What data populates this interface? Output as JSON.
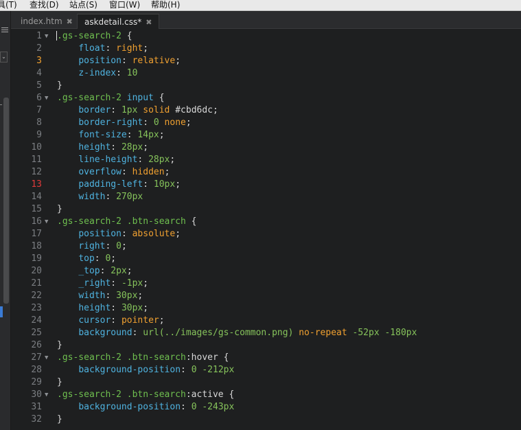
{
  "menu": {
    "items": [
      "具(T)",
      "查找(D)",
      "站点(S)",
      "窗口(W)",
      "帮助(H)"
    ]
  },
  "tabs": [
    {
      "label": "index.htm",
      "active": false
    },
    {
      "label": "askdetail.css*",
      "active": true
    }
  ],
  "editor": {
    "colors": {
      "background": "#1e1f20",
      "selector": "#6fbf4f",
      "property": "#4fb3e0",
      "value": "#f0a030",
      "number": "#86c35b",
      "punctuation": "#d8d8d8",
      "line_number": "#7b7e82",
      "line_number_warning": "#f0a030",
      "line_number_error": "#e03a3a"
    },
    "lines": [
      {
        "n": "1",
        "fold": true,
        "status": "",
        "tokens": [
          [
            "sel",
            ".gs-search-2 "
          ],
          [
            "punc",
            "{"
          ]
        ]
      },
      {
        "n": "2",
        "fold": false,
        "status": "",
        "tokens": [
          [
            "punc",
            "    "
          ],
          [
            "prop",
            "float"
          ],
          [
            "punc",
            ": "
          ],
          [
            "val",
            "right"
          ],
          [
            "punc",
            ";"
          ]
        ]
      },
      {
        "n": "3",
        "fold": false,
        "status": "warn",
        "tokens": [
          [
            "punc",
            "    "
          ],
          [
            "prop",
            "position"
          ],
          [
            "punc",
            ": "
          ],
          [
            "val",
            "relative"
          ],
          [
            "punc",
            ";"
          ]
        ]
      },
      {
        "n": "4",
        "fold": false,
        "status": "",
        "tokens": [
          [
            "punc",
            "    "
          ],
          [
            "prop",
            "z-index"
          ],
          [
            "punc",
            ": "
          ],
          [
            "num",
            "10"
          ]
        ]
      },
      {
        "n": "5",
        "fold": false,
        "status": "",
        "tokens": [
          [
            "punc",
            "}"
          ]
        ]
      },
      {
        "n": "6",
        "fold": true,
        "status": "",
        "tokens": [
          [
            "sel",
            ".gs-search-2 "
          ],
          [
            "tag",
            "input"
          ],
          [
            "punc",
            " {"
          ]
        ]
      },
      {
        "n": "7",
        "fold": false,
        "status": "",
        "tokens": [
          [
            "punc",
            "    "
          ],
          [
            "prop",
            "border"
          ],
          [
            "punc",
            ": "
          ],
          [
            "num",
            "1px"
          ],
          [
            "punc",
            " "
          ],
          [
            "val",
            "solid"
          ],
          [
            "punc",
            " #cbd6dc;"
          ]
        ]
      },
      {
        "n": "8",
        "fold": false,
        "status": "",
        "tokens": [
          [
            "punc",
            "    "
          ],
          [
            "prop",
            "border-right"
          ],
          [
            "punc",
            ": "
          ],
          [
            "num",
            "0"
          ],
          [
            "punc",
            " "
          ],
          [
            "val",
            "none"
          ],
          [
            "punc",
            ";"
          ]
        ]
      },
      {
        "n": "9",
        "fold": false,
        "status": "",
        "tokens": [
          [
            "punc",
            "    "
          ],
          [
            "prop",
            "font-size"
          ],
          [
            "punc",
            ": "
          ],
          [
            "num",
            "14px"
          ],
          [
            "punc",
            ";"
          ]
        ]
      },
      {
        "n": "10",
        "fold": false,
        "status": "",
        "tokens": [
          [
            "punc",
            "    "
          ],
          [
            "prop",
            "height"
          ],
          [
            "punc",
            ": "
          ],
          [
            "num",
            "28px"
          ],
          [
            "punc",
            ";"
          ]
        ]
      },
      {
        "n": "11",
        "fold": false,
        "status": "",
        "tokens": [
          [
            "punc",
            "    "
          ],
          [
            "prop",
            "line-height"
          ],
          [
            "punc",
            ": "
          ],
          [
            "num",
            "28px"
          ],
          [
            "punc",
            ";"
          ]
        ]
      },
      {
        "n": "12",
        "fold": false,
        "status": "",
        "tokens": [
          [
            "punc",
            "    "
          ],
          [
            "prop",
            "overflow"
          ],
          [
            "punc",
            ": "
          ],
          [
            "val",
            "hidden"
          ],
          [
            "punc",
            ";"
          ]
        ]
      },
      {
        "n": "13",
        "fold": false,
        "status": "err",
        "tokens": [
          [
            "punc",
            "    "
          ],
          [
            "prop",
            "padding-left"
          ],
          [
            "punc",
            ": "
          ],
          [
            "num",
            "10px"
          ],
          [
            "punc",
            ";"
          ]
        ]
      },
      {
        "n": "14",
        "fold": false,
        "status": "",
        "tokens": [
          [
            "punc",
            "    "
          ],
          [
            "prop",
            "width"
          ],
          [
            "punc",
            ": "
          ],
          [
            "num",
            "270px"
          ]
        ]
      },
      {
        "n": "15",
        "fold": false,
        "status": "",
        "tokens": [
          [
            "punc",
            "}"
          ]
        ]
      },
      {
        "n": "16",
        "fold": true,
        "status": "",
        "tokens": [
          [
            "sel",
            ".gs-search-2 .btn-search "
          ],
          [
            "punc",
            "{"
          ]
        ]
      },
      {
        "n": "17",
        "fold": false,
        "status": "",
        "tokens": [
          [
            "punc",
            "    "
          ],
          [
            "prop",
            "position"
          ],
          [
            "punc",
            ": "
          ],
          [
            "val",
            "absolute"
          ],
          [
            "punc",
            ";"
          ]
        ]
      },
      {
        "n": "18",
        "fold": false,
        "status": "",
        "tokens": [
          [
            "punc",
            "    "
          ],
          [
            "prop",
            "right"
          ],
          [
            "punc",
            ": "
          ],
          [
            "num",
            "0"
          ],
          [
            "punc",
            ";"
          ]
        ]
      },
      {
        "n": "19",
        "fold": false,
        "status": "",
        "tokens": [
          [
            "punc",
            "    "
          ],
          [
            "prop",
            "top"
          ],
          [
            "punc",
            ": "
          ],
          [
            "num",
            "0"
          ],
          [
            "punc",
            ";"
          ]
        ]
      },
      {
        "n": "20",
        "fold": false,
        "status": "",
        "tokens": [
          [
            "punc",
            "    "
          ],
          [
            "prop",
            "_top"
          ],
          [
            "punc",
            ": "
          ],
          [
            "num",
            "2px"
          ],
          [
            "punc",
            ";"
          ]
        ]
      },
      {
        "n": "21",
        "fold": false,
        "status": "",
        "tokens": [
          [
            "punc",
            "    "
          ],
          [
            "prop",
            "_right"
          ],
          [
            "punc",
            ": "
          ],
          [
            "num",
            "-1px"
          ],
          [
            "punc",
            ";"
          ]
        ]
      },
      {
        "n": "22",
        "fold": false,
        "status": "",
        "tokens": [
          [
            "punc",
            "    "
          ],
          [
            "prop",
            "width"
          ],
          [
            "punc",
            ": "
          ],
          [
            "num",
            "30px"
          ],
          [
            "punc",
            ";"
          ]
        ]
      },
      {
        "n": "23",
        "fold": false,
        "status": "",
        "tokens": [
          [
            "punc",
            "    "
          ],
          [
            "prop",
            "height"
          ],
          [
            "punc",
            ": "
          ],
          [
            "num",
            "30px"
          ],
          [
            "punc",
            ";"
          ]
        ]
      },
      {
        "n": "24",
        "fold": false,
        "status": "",
        "tokens": [
          [
            "punc",
            "    "
          ],
          [
            "prop",
            "cursor"
          ],
          [
            "punc",
            ": "
          ],
          [
            "val",
            "pointer"
          ],
          [
            "punc",
            ";"
          ]
        ]
      },
      {
        "n": "25",
        "fold": false,
        "status": "",
        "tokens": [
          [
            "punc",
            "    "
          ],
          [
            "prop",
            "background"
          ],
          [
            "punc",
            ": "
          ],
          [
            "num",
            "url(../images/gs-common.png)"
          ],
          [
            "punc",
            " "
          ],
          [
            "val",
            "no-repeat"
          ],
          [
            "punc",
            " "
          ],
          [
            "num",
            "-52px"
          ],
          [
            "punc",
            " "
          ],
          [
            "num",
            "-180px"
          ]
        ]
      },
      {
        "n": "26",
        "fold": false,
        "status": "",
        "tokens": [
          [
            "punc",
            "}"
          ]
        ]
      },
      {
        "n": "27",
        "fold": true,
        "status": "",
        "tokens": [
          [
            "sel",
            ".gs-search-2 .btn-search"
          ],
          [
            "pseudo",
            ":hover"
          ],
          [
            "punc",
            " {"
          ]
        ]
      },
      {
        "n": "28",
        "fold": false,
        "status": "",
        "tokens": [
          [
            "punc",
            "    "
          ],
          [
            "prop",
            "background-position"
          ],
          [
            "punc",
            ": "
          ],
          [
            "num",
            "0"
          ],
          [
            "punc",
            " "
          ],
          [
            "num",
            "-212px"
          ]
        ]
      },
      {
        "n": "29",
        "fold": false,
        "status": "",
        "tokens": [
          [
            "punc",
            "}"
          ]
        ]
      },
      {
        "n": "30",
        "fold": true,
        "status": "",
        "tokens": [
          [
            "sel",
            ".gs-search-2 .btn-search"
          ],
          [
            "pseudo",
            ":active"
          ],
          [
            "punc",
            " {"
          ]
        ]
      },
      {
        "n": "31",
        "fold": false,
        "status": "",
        "tokens": [
          [
            "punc",
            "    "
          ],
          [
            "prop",
            "background-position"
          ],
          [
            "punc",
            ": "
          ],
          [
            "num",
            "0"
          ],
          [
            "punc",
            " "
          ],
          [
            "num",
            "-243px"
          ]
        ]
      },
      {
        "n": "32",
        "fold": false,
        "status": "",
        "tokens": [
          [
            "punc",
            "}"
          ]
        ]
      }
    ]
  }
}
